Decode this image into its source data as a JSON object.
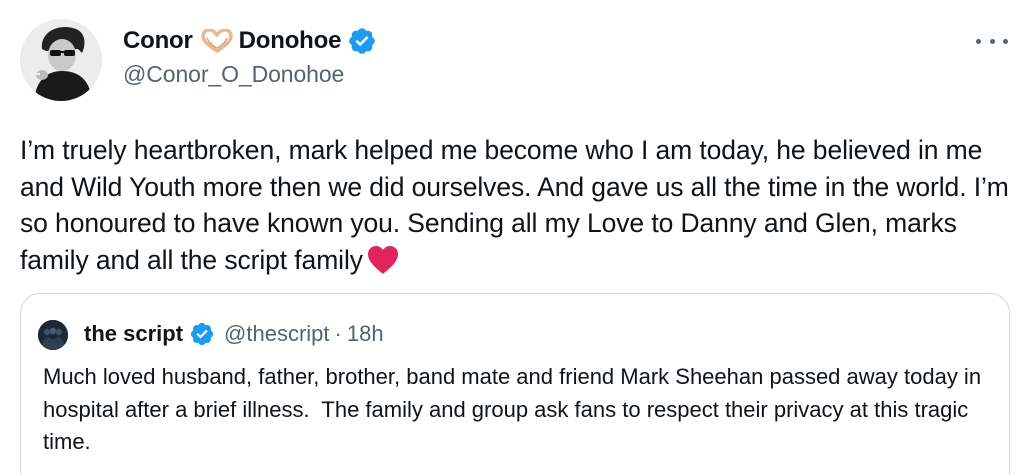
{
  "author": {
    "name_first": "Conor",
    "name_last": "Donohoe",
    "handle": "@Conor_O_Donohoe"
  },
  "tweet": {
    "text": "I’m truely heartbroken, mark helped me become who I am today, he believed in me and Wild Youth more then we did ourselves. And gave us all the time in the world. I’m so honoured to have known you. Sending all my Love to Danny and Glen, marks family and all the script family"
  },
  "quoted_tweet": {
    "name": "the script",
    "handle": "@thescript",
    "separator": "·",
    "time": "18h",
    "text": "Much loved husband, father, brother, band mate and friend Mark Sheehan passed away today in hospital after a brief illness.  The family and group ask fans to respect their privacy at this tragic time."
  },
  "icons": {
    "name_emoji": "heart-hands-icon",
    "verified": "verified-badge-icon",
    "more": "more-icon",
    "text_emoji": "red-heart-icon"
  },
  "colors": {
    "verified_blue": "#1d9bf0",
    "secondary_text": "#536471",
    "border": "#cfd9de",
    "heart_red": "#e0245e"
  }
}
